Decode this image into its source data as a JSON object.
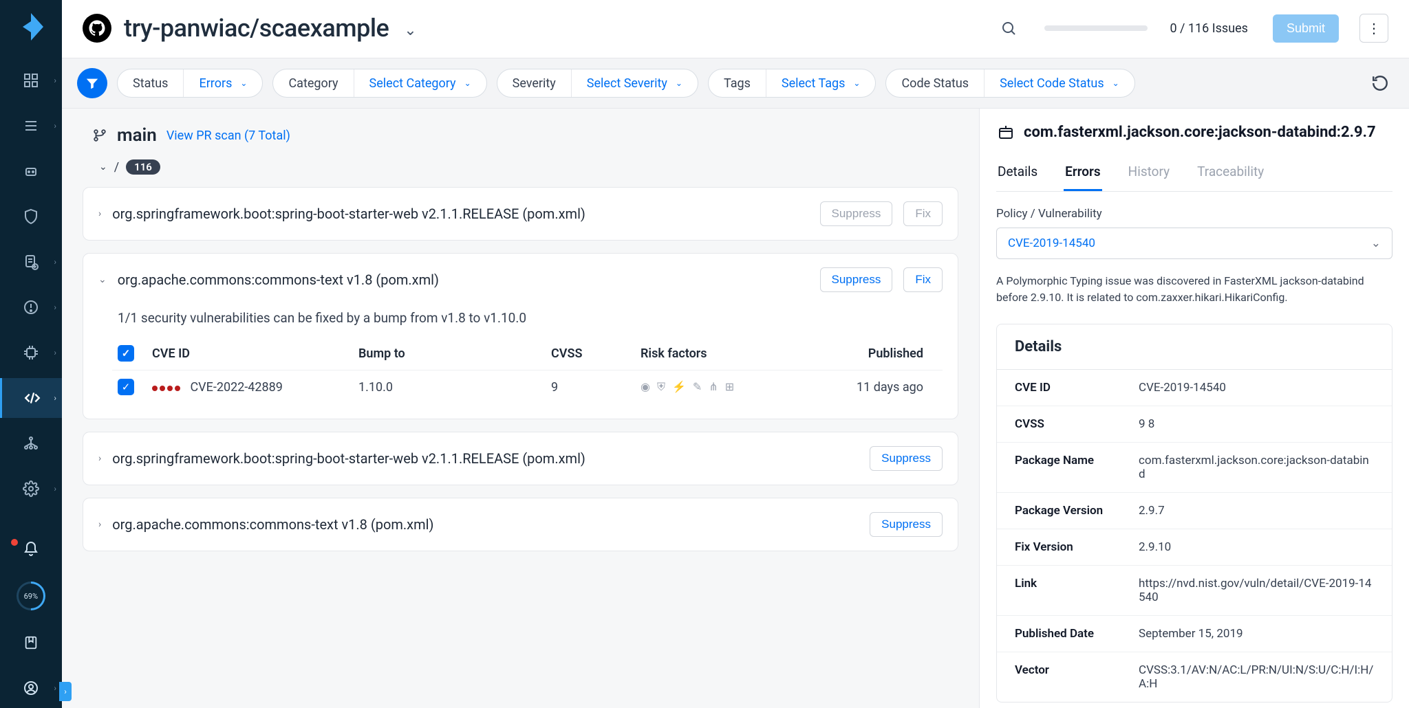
{
  "header": {
    "repo": "try-panwiac/scaexample",
    "issues_count": "0 / 116 Issues",
    "submit_label": "Submit"
  },
  "filters": {
    "status": {
      "label": "Status",
      "value": "Errors"
    },
    "category": {
      "label": "Category",
      "value": "Select Category"
    },
    "severity": {
      "label": "Severity",
      "value": "Select Severity"
    },
    "tags": {
      "label": "Tags",
      "value": "Select Tags"
    },
    "code_status": {
      "label": "Code Status",
      "value": "Select Code Status"
    }
  },
  "branch": {
    "name": "main",
    "pr_link": "View PR scan (7 Total)",
    "path_sep": "/",
    "count": "116"
  },
  "packages": [
    {
      "name": "org.springframework.boot:spring-boot-starter-web v2.1.1.RELEASE (pom.xml)",
      "suppress": "Suppress",
      "fix": "Fix",
      "suppress_muted": true,
      "fix_muted": true,
      "expanded": false
    },
    {
      "name": "org.apache.commons:commons-text v1.8 (pom.xml)",
      "suppress": "Suppress",
      "fix": "Fix",
      "suppress_muted": false,
      "fix_muted": false,
      "expanded": true,
      "fix_hint": "1/1 security vulnerabilities can be fixed by a bump from v1.8 to v1.10.0",
      "columns": {
        "cve": "CVE ID",
        "bump": "Bump to",
        "cvss": "CVSS",
        "risk": "Risk factors",
        "published": "Published"
      },
      "rows": [
        {
          "cve": "CVE-2022-42889",
          "bump": "1.10.0",
          "cvss": "9",
          "published": "11 days ago"
        }
      ]
    },
    {
      "name": "org.springframework.boot:spring-boot-starter-web v2.1.1.RELEASE (pom.xml)",
      "suppress": "Suppress",
      "suppress_muted": false,
      "expanded": false
    },
    {
      "name": "org.apache.commons:commons-text v1.8 (pom.xml)",
      "suppress": "Suppress",
      "suppress_muted": false,
      "expanded": false
    }
  ],
  "right": {
    "title": "com.fasterxml.jackson.core:jackson-databind:2.9.7",
    "tabs": {
      "details": "Details",
      "errors": "Errors",
      "history": "History",
      "traceability": "Traceability"
    },
    "policy_label": "Policy / Vulnerability",
    "policy_value": "CVE-2019-14540",
    "description": "A Polymorphic Typing issue was discovered in FasterXML jackson-databind before 2.9.10. It is related to com.zaxxer.hikari.HikariConfig.",
    "details_header": "Details",
    "rows": {
      "cve_id": {
        "k": "CVE ID",
        "v": "CVE-2019-14540"
      },
      "cvss": {
        "k": "CVSS",
        "v": "9 8"
      },
      "pkg_name": {
        "k": "Package Name",
        "v": "com.fasterxml.jackson.core:jackson-databind"
      },
      "pkg_ver": {
        "k": "Package Version",
        "v": "2.9.7"
      },
      "fix_ver": {
        "k": "Fix Version",
        "v": "2.9.10"
      },
      "link": {
        "k": "Link",
        "v": "https://nvd.nist.gov/vuln/detail/CVE-2019-14540"
      },
      "pub_date": {
        "k": "Published Date",
        "v": "September 15, 2019"
      },
      "vector": {
        "k": "Vector",
        "v": "CVSS:3.1/AV:N/AC:L/PR:N/UI:N/S:U/C:H/I:H/A:H"
      }
    }
  },
  "nav_gauge": "69%"
}
